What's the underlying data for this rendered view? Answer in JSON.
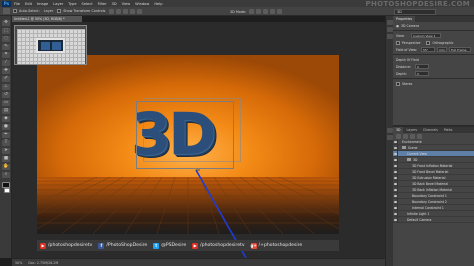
{
  "menubar": {
    "logo": "Ps",
    "items": [
      "File",
      "Edit",
      "Image",
      "Layer",
      "Type",
      "Select",
      "Filter",
      "3D",
      "View",
      "Window",
      "Help"
    ],
    "watermark": "PHOTOSHOPDESIRE.COM"
  },
  "options_bar": {
    "auto_select_label": "Auto-Select:",
    "auto_select_value": "Layer",
    "transform_label": "Show Transform Controls",
    "mode_label": "3D Mode:",
    "workspace": "3D"
  },
  "document_tab": {
    "title": "Untitled-1 @ 50% (3D, RGB/8) *"
  },
  "canvas": {
    "headline": "3D"
  },
  "social": [
    {
      "icon": "youtube-icon",
      "glyph": "▶",
      "color": "#d93025",
      "label": "/photoshopdesiretv"
    },
    {
      "icon": "facebook-icon",
      "glyph": "f",
      "color": "#3b5998",
      "label": "/PhotoShopDesire"
    },
    {
      "icon": "twitter-icon",
      "glyph": "t",
      "color": "#1da1f2",
      "label": "@PSDesire"
    },
    {
      "icon": "youtube-icon",
      "glyph": "▶",
      "color": "#d93025",
      "label": "/photoshopdesiretv"
    },
    {
      "icon": "googleplus-icon",
      "glyph": "g+",
      "color": "#dd4b39",
      "label": "/+photoshopdesire"
    }
  ],
  "status_bar": {
    "zoom": "50%",
    "doc": "Doc: 2.75M/26.2M"
  },
  "properties_panel": {
    "tabs": [
      "Properties"
    ],
    "header": "3D Camera",
    "view_label": "View:",
    "view_value": "Custom View 1",
    "perspective_label": "Perspective",
    "orthographic_label": "Orthographic",
    "fov_label": "Field of View:",
    "fov_value": "55°",
    "fov_unit": "mm",
    "lens_value": "Full Frame",
    "dof_label": "Depth Of Field",
    "distance_label": "Distance:",
    "distance_value": "0",
    "depth_label": "Depth:",
    "depth_value": "0",
    "stereo_label": "Stereo"
  },
  "layers_panel": {
    "tabs": [
      "3D",
      "Layers",
      "Channels",
      "Paths"
    ],
    "rows": [
      {
        "text": "Environment",
        "level": 1,
        "selected": false,
        "folder": false
      },
      {
        "text": "Scene",
        "level": 1,
        "selected": false,
        "folder": true
      },
      {
        "text": "Current View",
        "level": 2,
        "selected": true,
        "folder": false
      },
      {
        "text": "3D",
        "level": 2,
        "selected": false,
        "folder": true
      },
      {
        "text": "3D Front Inflation Material",
        "level": 3,
        "selected": false,
        "folder": false
      },
      {
        "text": "3D Front Bevel Material",
        "level": 3,
        "selected": false,
        "folder": false
      },
      {
        "text": "3D Extrusion Material",
        "level": 3,
        "selected": false,
        "folder": false
      },
      {
        "text": "3D Back Bevel Material",
        "level": 3,
        "selected": false,
        "folder": false
      },
      {
        "text": "3D Back Inflation Material",
        "level": 3,
        "selected": false,
        "folder": false
      },
      {
        "text": "Boundary Constraint 1",
        "level": 3,
        "selected": false,
        "folder": false
      },
      {
        "text": "Boundary Constraint 2",
        "level": 3,
        "selected": false,
        "folder": false
      },
      {
        "text": "Internal Constraint 1",
        "level": 3,
        "selected": false,
        "folder": false
      },
      {
        "text": "Infinite Light 1",
        "level": 2,
        "selected": false,
        "folder": false
      },
      {
        "text": "Default Camera",
        "level": 2,
        "selected": false,
        "folder": false
      }
    ]
  }
}
